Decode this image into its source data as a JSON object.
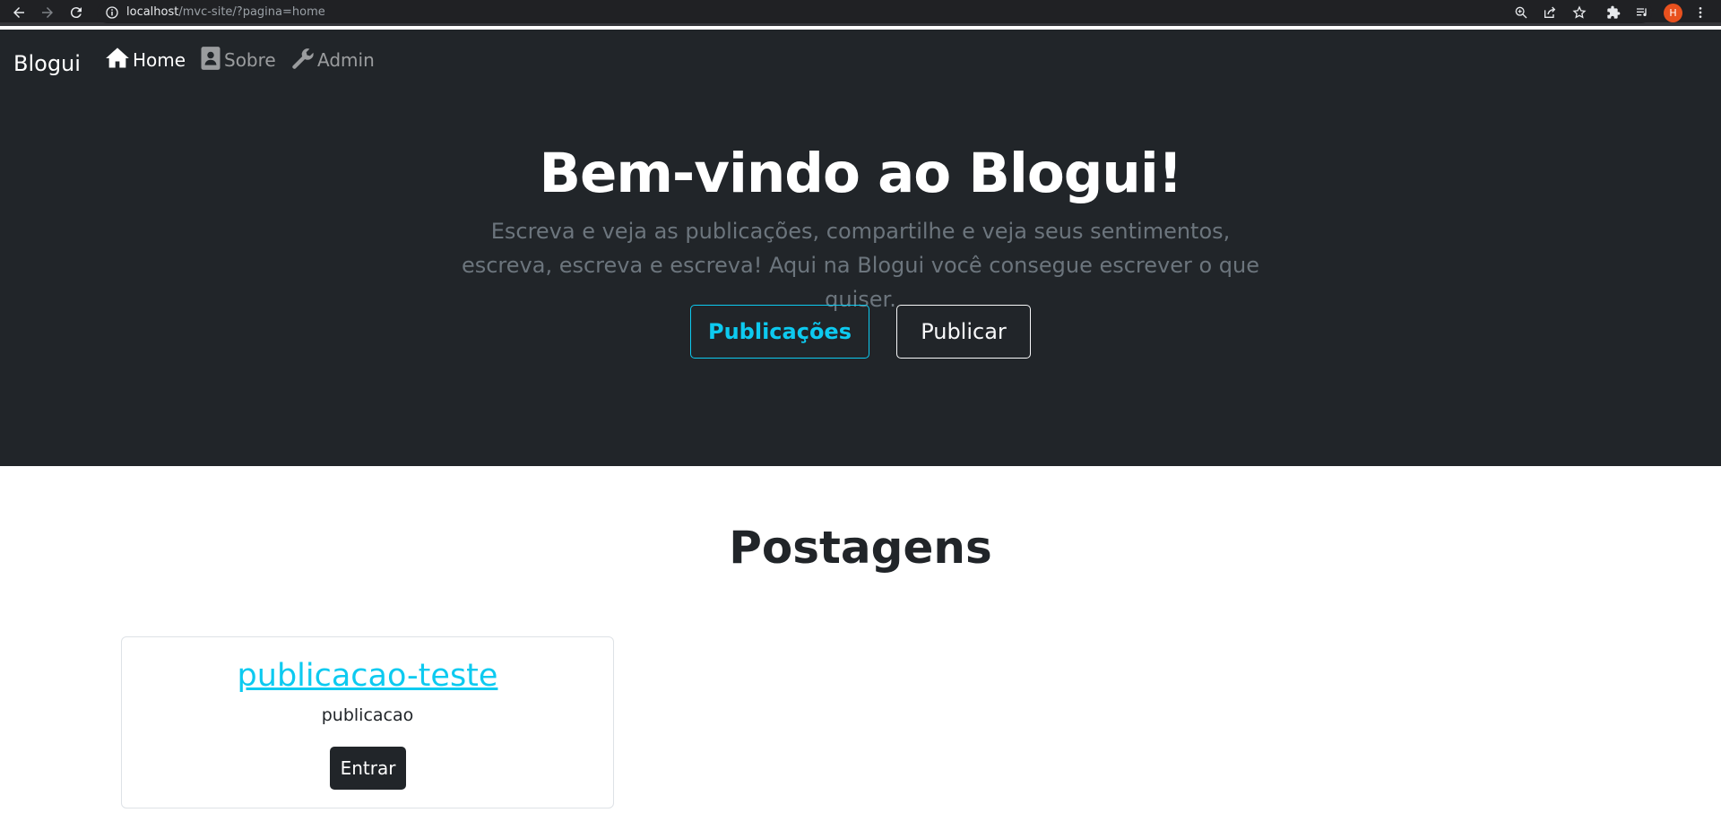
{
  "browser": {
    "url_host": "localhost",
    "url_path": "/mvc-site/?pagina=home",
    "profile_initial": "H"
  },
  "navbar": {
    "brand": "Blogui",
    "items": [
      {
        "label": "Home",
        "icon": "house-icon",
        "active": true
      },
      {
        "label": "Sobre",
        "icon": "contact-card-icon",
        "active": false
      },
      {
        "label": "Admin",
        "icon": "wrench-icon",
        "active": false
      }
    ]
  },
  "hero": {
    "title": "Bem-vindo ao Blogui!",
    "lead": "Escreva e veja as publicações, compartilhe e veja seus sentimentos, escreva, escreva e escreva! Aqui na Blogui você consegue escrever o que quiser.",
    "primary_button": "Publicações",
    "secondary_button": "Publicar"
  },
  "posts": {
    "heading": "Postagens",
    "items": [
      {
        "title": "publicacao-teste",
        "text": "publicacao",
        "button": "Entrar"
      }
    ]
  },
  "colors": {
    "dark": "#212529",
    "info": "#0dcaf0",
    "muted": "#6c757d"
  }
}
